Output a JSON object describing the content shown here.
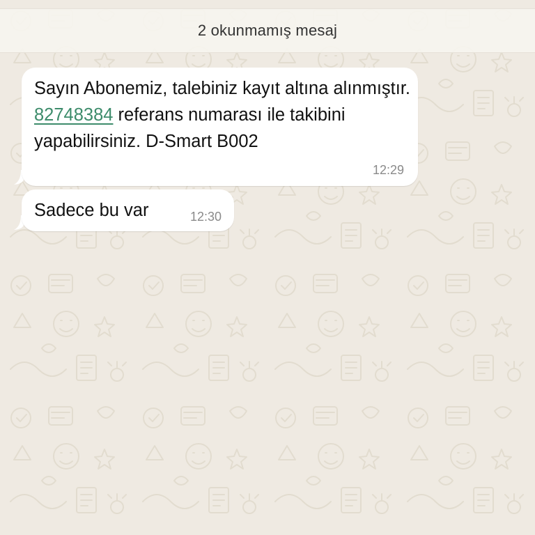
{
  "chat": {
    "unread_banner": "2 okunmamış mesaj",
    "messages": [
      {
        "text_before": "Sayın Abonemiz, talebiniz kayıt altına alınmıştır. ",
        "reference_number": "82748384",
        "text_after": " referans numarası ile takibini yapabilirsiniz. D-Smart B002",
        "time": "12:29"
      },
      {
        "text": "Sadece bu var",
        "time": "12:30"
      }
    ]
  },
  "colors": {
    "wallpaper": "#efeae2",
    "bubble": "#ffffff",
    "link": "#3d8c6b",
    "timestamp": "#8a8a8a"
  }
}
